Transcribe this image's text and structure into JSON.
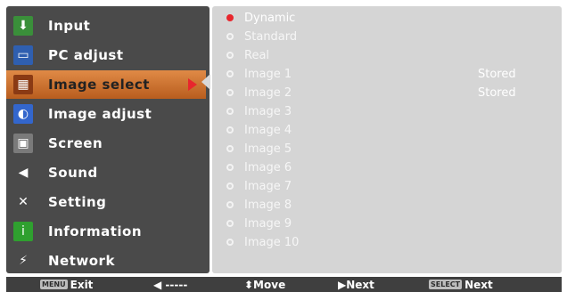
{
  "menu": {
    "items": [
      {
        "label": "Input",
        "icon": "input-icon",
        "glyph": "⬇",
        "color": "#3a8f3a"
      },
      {
        "label": "PC adjust",
        "icon": "monitor-icon",
        "glyph": "▭",
        "color": "#2f5fb0"
      },
      {
        "label": "Image select",
        "icon": "image-select-icon",
        "glyph": "▦",
        "color": "#c0602a"
      },
      {
        "label": "Image adjust",
        "icon": "image-adjust-icon",
        "glyph": "◐",
        "color": "#3366cc"
      },
      {
        "label": "Screen",
        "icon": "screen-icon",
        "glyph": "▣",
        "color": "#7a7a7a"
      },
      {
        "label": "Sound",
        "icon": "speaker-icon",
        "glyph": "◀",
        "color": "#4a4a4a"
      },
      {
        "label": "Setting",
        "icon": "wrench-icon",
        "glyph": "✕",
        "color": "#4a4a4a"
      },
      {
        "label": "Information",
        "icon": "info-icon",
        "glyph": "i",
        "color": "#2fa02f"
      },
      {
        "label": "Network",
        "icon": "network-icon",
        "glyph": "⚡",
        "color": "#4a4a4a"
      }
    ],
    "selected_index": 2
  },
  "options": {
    "items": [
      {
        "label": "Dynamic",
        "active": true
      },
      {
        "label": "Standard",
        "active": false
      },
      {
        "label": "Real",
        "active": false
      },
      {
        "label": "Image 1",
        "active": false,
        "note": "Stored"
      },
      {
        "label": "Image 2",
        "active": false,
        "note": "Stored"
      },
      {
        "label": "Image 3",
        "active": false
      },
      {
        "label": "Image 4",
        "active": false
      },
      {
        "label": "Image 5",
        "active": false
      },
      {
        "label": "Image 6",
        "active": false
      },
      {
        "label": "Image 7",
        "active": false
      },
      {
        "label": "Image 8",
        "active": false
      },
      {
        "label": "Image 9",
        "active": false
      },
      {
        "label": "Image 10",
        "active": false
      }
    ]
  },
  "footer": {
    "exit_key": "MENU",
    "exit_label": "Exit",
    "back_label": "◀ -----",
    "move_label": "⬍Move",
    "next_arrow_label": "▶Next",
    "select_key": "SELECT",
    "select_label": "Next"
  },
  "colors": {
    "accent": "#e8262d",
    "selected_row": "#d0752f",
    "menu_bg": "#4a4a4a",
    "panel_bg": "#d5d5d5"
  }
}
